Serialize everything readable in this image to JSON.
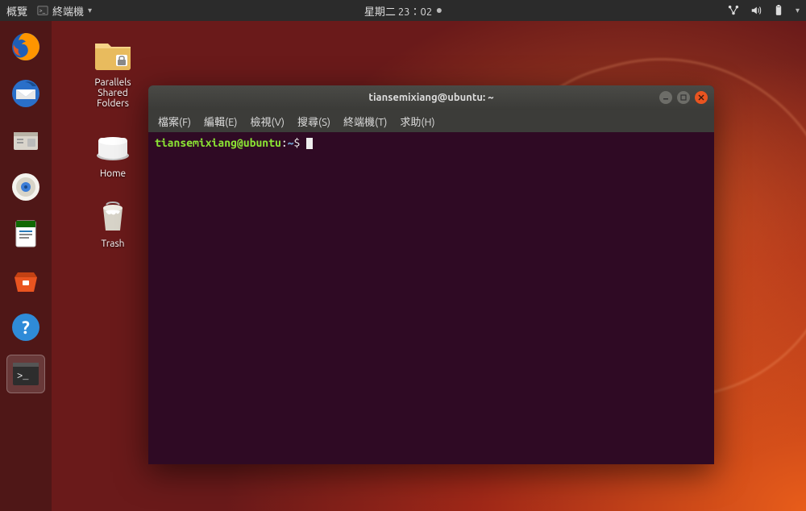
{
  "topbar": {
    "overview_label": "概覽",
    "active_app_label": "終端機",
    "clock": "星期二 23：02"
  },
  "status_icons": {
    "network": "network-icon",
    "volume": "volume-icon",
    "battery": "battery-icon",
    "arrow": "▾"
  },
  "dock": {
    "items": [
      {
        "name": "firefox"
      },
      {
        "name": "thunderbird"
      },
      {
        "name": "files"
      },
      {
        "name": "rhythmbox"
      },
      {
        "name": "writer"
      },
      {
        "name": "software"
      },
      {
        "name": "help"
      },
      {
        "name": "terminal",
        "active": true
      }
    ]
  },
  "desktop_icons": [
    {
      "label": "Parallels\nShared\nFolders",
      "kind": "folder-shared"
    },
    {
      "label": "Home",
      "kind": "drive"
    },
    {
      "label": "Trash",
      "kind": "trash"
    }
  ],
  "terminal": {
    "title": "tiansemixiang@ubuntu: ~",
    "menu": [
      "檔案(F)",
      "編輯(E)",
      "檢視(V)",
      "搜尋(S)",
      "終端機(T)",
      "求助(H)"
    ],
    "prompt": {
      "userhost": "tiansemixiang@ubuntu",
      "separator": ":",
      "path": "~",
      "symbol": "$"
    }
  }
}
